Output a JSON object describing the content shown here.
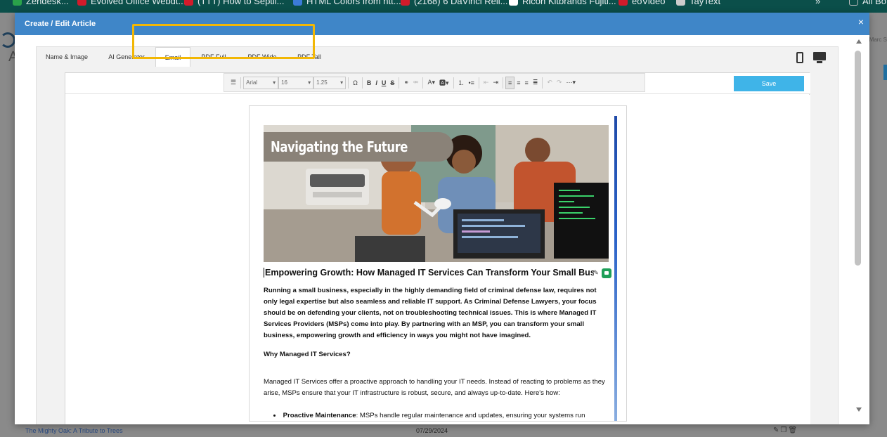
{
  "browser": {
    "bookmarks": [
      {
        "label": "Zendesk...",
        "color": "#2aa24a"
      },
      {
        "label": "Evolved Office Webdt...",
        "color": "#d11b2b"
      },
      {
        "label": "(TTT) How to Septil...",
        "color": "#d11b2b"
      },
      {
        "label": "HTML Colors from htt...",
        "color": "#3b7bd8"
      },
      {
        "label": "(2168) 6 DaVinci Reli...",
        "color": "#d11b2b"
      },
      {
        "label": "Ricoh Kitbrands Fujiti...",
        "color": "#ffffff"
      },
      {
        "label": "eoVideo",
        "color": "#d11b2b"
      },
      {
        "label": "TayText",
        "color": "#cccccc"
      },
      {
        "label": "All Bo",
        "color": "#bbbbbb"
      }
    ]
  },
  "background": {
    "letter": "A",
    "user": "Marc S",
    "row_title": "The Mighty Oak: A Tribute to Trees",
    "row_date": "07/29/2024"
  },
  "modal": {
    "title": "Create / Edit Article",
    "close": "×"
  },
  "tabs": [
    {
      "label": "Name & Image",
      "active": false
    },
    {
      "label": "AI Generator",
      "active": false
    },
    {
      "label": "Email",
      "active": true
    },
    {
      "label": "PDF Full",
      "active": false
    },
    {
      "label": "PDF Wide",
      "active": false
    },
    {
      "label": "PDF Tall",
      "active": false
    }
  ],
  "toolbar": {
    "font": "Arial",
    "size": "16",
    "line_height": "1.25",
    "save_label": "Save"
  },
  "email": {
    "hero_title": "Navigating the Future",
    "headline": "Empowering Growth: How Managed IT Services Can Transform Your Small Busin",
    "intro": "Running a small business, especially in the highly demanding field of criminal defense law, requires not only legal expertise but also seamless and reliable IT support. As Criminal Defense Lawyers, your focus should be on defending your clients, not on troubleshooting technical issues. This is where Managed IT Services Providers (MSPs) come into play. By partnering with an MSP, you can transform your small business, empowering growth and efficiency in ways you might not have imagined.",
    "section_heading": "Why Managed IT Services?",
    "paragraph": "Managed IT Services offer a proactive approach to handling your IT needs. Instead of reacting to problems as they arise, MSPs ensure that your IT infrastructure is robust, secure, and always up-to-date. Here's how:",
    "bullet_label": "Proactive Maintenance",
    "bullet_text": ": MSPs handle regular maintenance and updates, ensuring your systems run"
  },
  "colors": {
    "header": "#3f86c8",
    "save": "#3fb4e8",
    "highlight": "#f2b705",
    "ai_badge": "#1e9f58"
  }
}
